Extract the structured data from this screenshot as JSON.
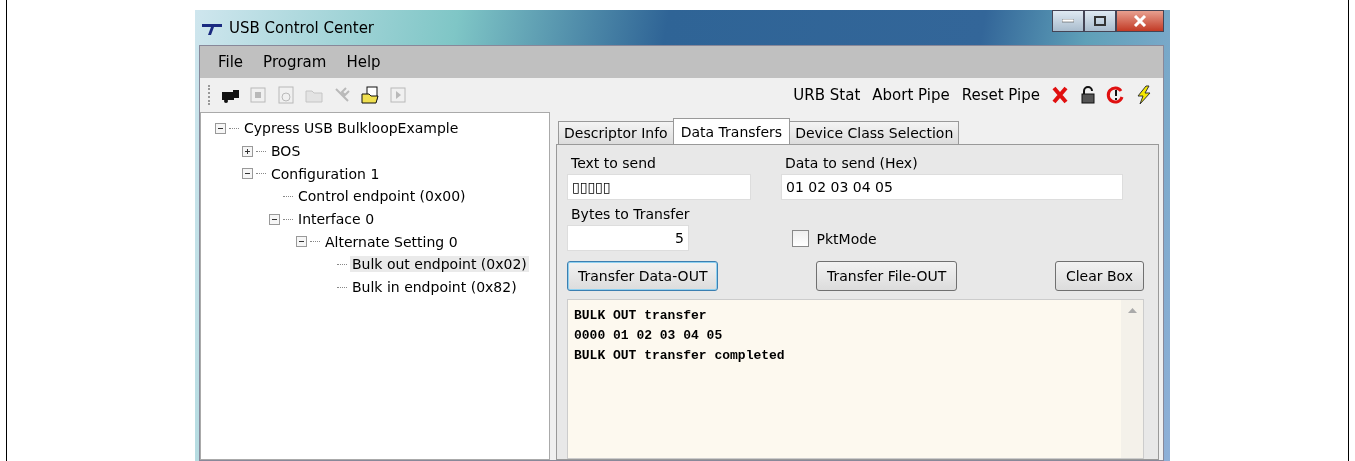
{
  "window": {
    "title": "USB Control Center"
  },
  "menu": [
    "File",
    "Program",
    "Help"
  ],
  "toolbar": {
    "icons": [
      {
        "kind": "camera",
        "disabled": false
      },
      {
        "kind": "stop",
        "disabled": true
      },
      {
        "kind": "clock",
        "disabled": true
      },
      {
        "kind": "folder",
        "disabled": true
      },
      {
        "kind": "tools",
        "disabled": true
      },
      {
        "kind": "file",
        "disabled": false
      },
      {
        "kind": "play",
        "disabled": true
      }
    ],
    "actions": [
      "URB Stat",
      "Abort Pipe",
      "Reset Pipe"
    ],
    "right_icons": [
      {
        "kind": "cross"
      },
      {
        "kind": "lock"
      },
      {
        "kind": "refresh"
      },
      {
        "kind": "bolt"
      }
    ]
  },
  "tree": [
    {
      "label": "Cypress USB BulkloopExample",
      "expanded": true,
      "selected": false,
      "children": [
        {
          "label": "BOS",
          "expanded": false,
          "selected": false
        },
        {
          "label": "Configuration 1",
          "expanded": true,
          "selected": false,
          "children": [
            {
              "label": "Control endpoint (0x00)",
              "selected": false
            },
            {
              "label": "Interface 0",
              "expanded": true,
              "selected": false,
              "children": [
                {
                  "label": "Alternate Setting 0",
                  "expanded": true,
                  "selected": false,
                  "children": [
                    {
                      "label": "Bulk out endpoint (0x02)",
                      "selected": true
                    },
                    {
                      "label": "Bulk in endpoint (0x82)",
                      "selected": false
                    }
                  ]
                }
              ]
            }
          ]
        }
      ]
    }
  ],
  "tabs": [
    {
      "label": "Descriptor Info",
      "selected": false
    },
    {
      "label": "Data Transfers",
      "selected": true
    },
    {
      "label": "Device Class Selection",
      "selected": false
    }
  ],
  "form": {
    "text_to_send": {
      "label": "Text to send",
      "value": "▯▯▯▯▯"
    },
    "data_to_send": {
      "label": "Data to send (Hex)",
      "value": "01 02 03 04 05"
    },
    "bytes_to_transfer": {
      "label": "Bytes to Transfer",
      "value": "5"
    },
    "pkt_mode": {
      "label": "PktMode",
      "checked": false
    }
  },
  "buttons": [
    {
      "label": "Transfer Data-OUT",
      "focused": true
    },
    {
      "label": "Transfer File-OUT",
      "focused": false
    },
    {
      "label": "Clear Box",
      "focused": false
    }
  ],
  "log": [
    "BULK OUT transfer",
    "0000 01 02 03 04 05",
    "BULK OUT transfer completed"
  ]
}
